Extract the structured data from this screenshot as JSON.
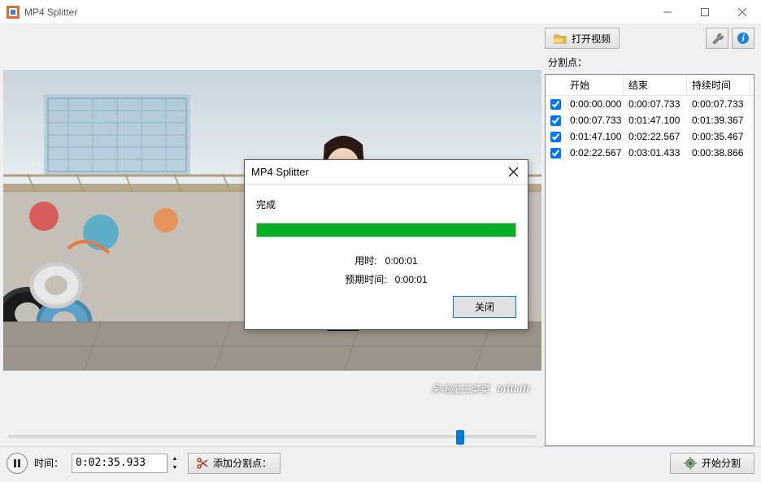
{
  "window": {
    "title": "MP4 Splitter"
  },
  "toolbar": {
    "open_video": "打开视频",
    "split_points_label": "分割点："
  },
  "table": {
    "headers": {
      "start": "开始",
      "end": "结束",
      "duration": "持续时间"
    },
    "rows": [
      {
        "checked": true,
        "start": "0:00:00.000",
        "end": "0:00:07.733",
        "duration": "0:00:07.733"
      },
      {
        "checked": true,
        "start": "0:00:07.733",
        "end": "0:01:47.100",
        "duration": "0:01:39.367"
      },
      {
        "checked": true,
        "start": "0:01:47.100",
        "end": "0:02:22.567",
        "duration": "0:00:35.467"
      },
      {
        "checked": true,
        "start": "0:02:22.567",
        "end": "0:03:01.433",
        "duration": "0:00:38.866"
      }
    ]
  },
  "video": {
    "watermark_author": "呆毛魔王菜菜",
    "watermark_site": "bilibili"
  },
  "slider": {
    "position_percent": 85.6
  },
  "footer": {
    "time_label": "时间：",
    "time_value": "0:02:35.933",
    "add_split_point": "添加分割点：",
    "start_split": "开始分割"
  },
  "dialog": {
    "title": "MP4 Splitter",
    "status": "完成",
    "progress_percent": 100,
    "elapsed_label": "用时:",
    "elapsed_value": "0:00:01",
    "expected_label": "预期时间:",
    "expected_value": "0:00:01",
    "close": "关闭"
  }
}
